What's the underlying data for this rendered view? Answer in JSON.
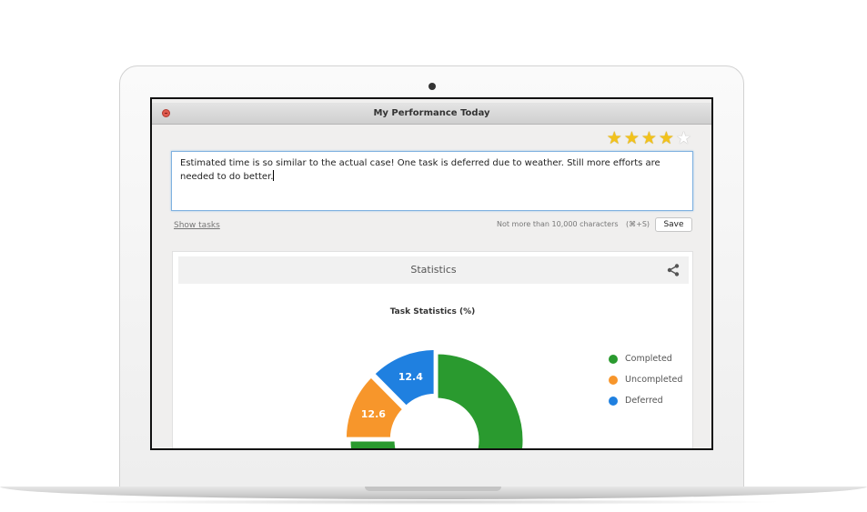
{
  "window": {
    "title": "My Performance Today"
  },
  "rating": {
    "value": 4,
    "max": 5
  },
  "note": {
    "text": "Estimated time is so similar to the actual case! One task is deferred due to weather. Still more efforts are needed to do better."
  },
  "actions": {
    "show_tasks": "Show tasks",
    "char_limit": "Not more than 10,000 characters",
    "shortcut": "(⌘+S)",
    "save": "Save"
  },
  "statistics": {
    "header": "Statistics"
  },
  "chart_data": {
    "type": "pie",
    "title": "Task Statistics (%)",
    "categories": [
      "Completed",
      "Uncompleted",
      "Deferred"
    ],
    "values": [
      75.0,
      12.6,
      12.4
    ],
    "data_labels": [
      "",
      "12.6",
      "12.4"
    ],
    "colors": [
      "#2a9a2f",
      "#f7962b",
      "#1f80e0"
    ],
    "legend_position": "right"
  }
}
